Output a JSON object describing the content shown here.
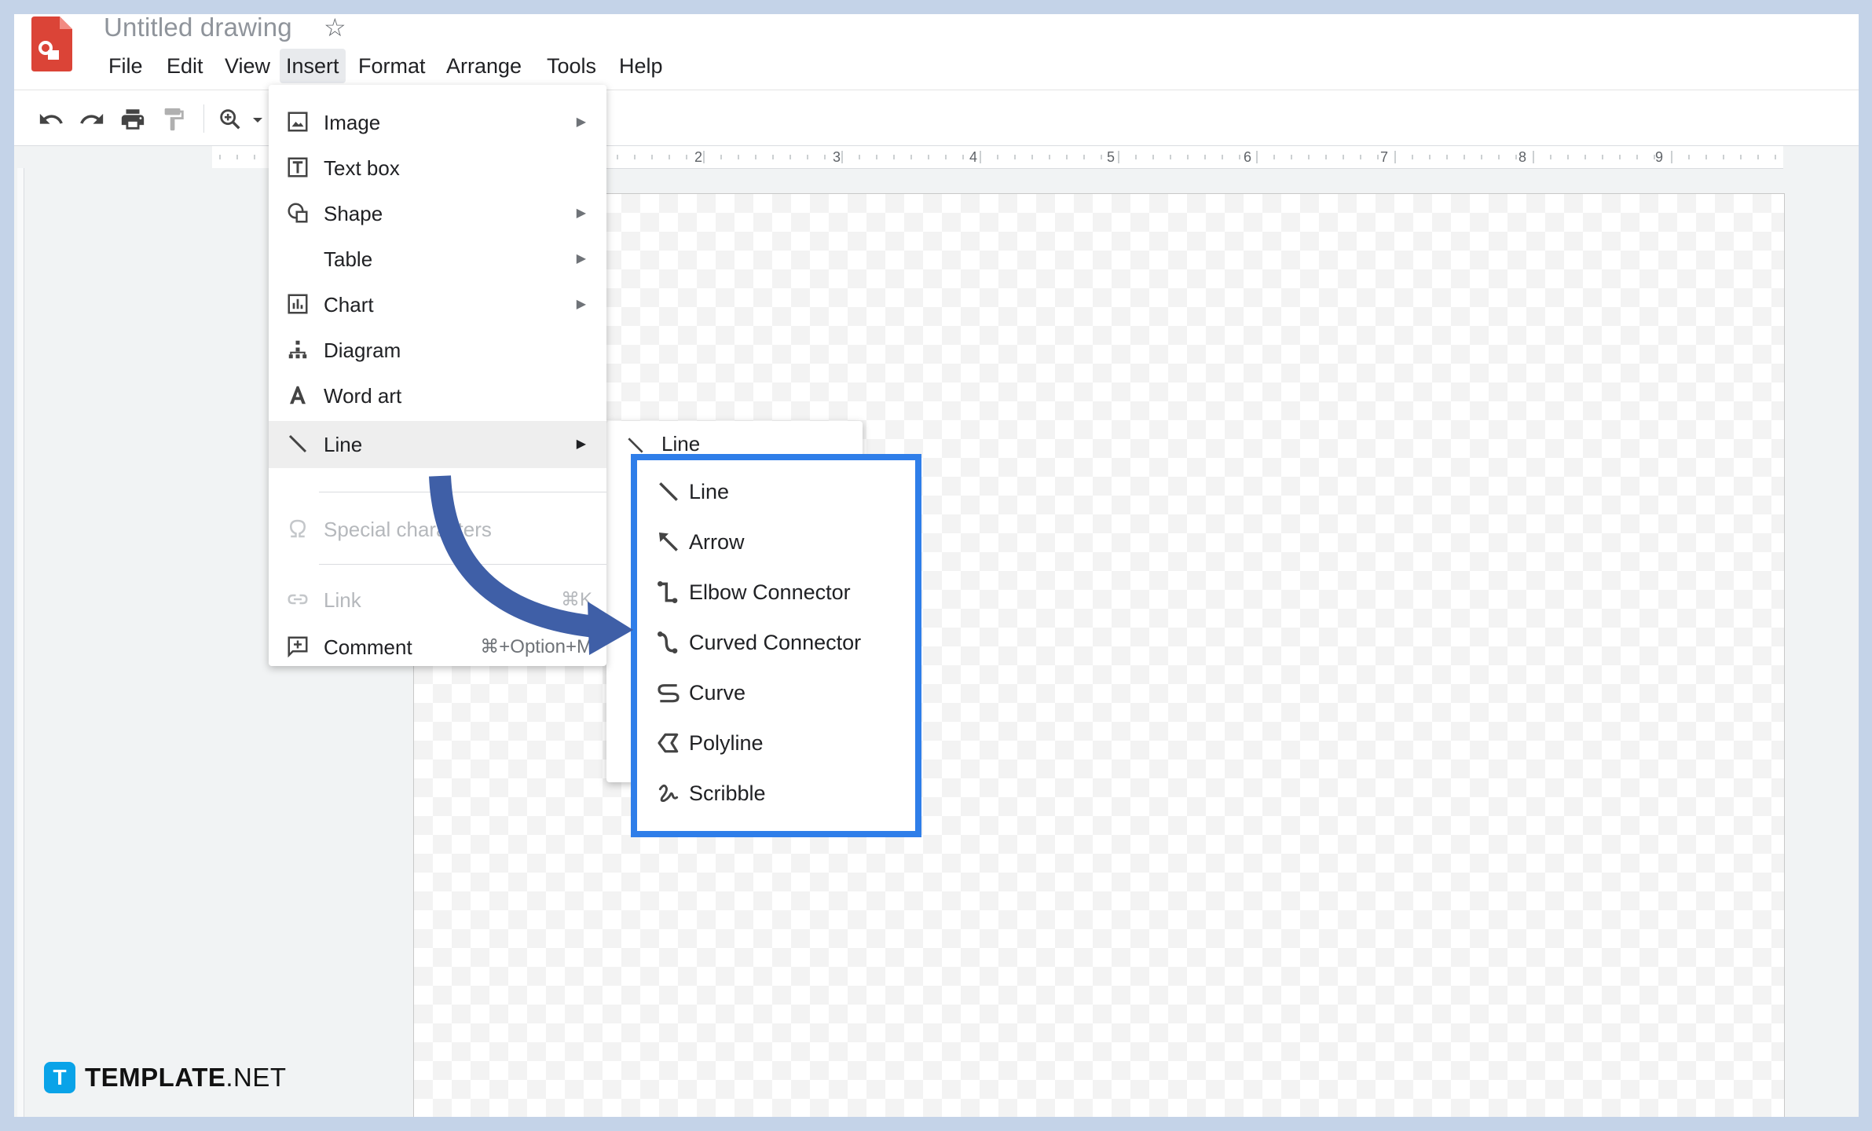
{
  "document": {
    "title": "Untitled drawing"
  },
  "menubar": {
    "items": [
      "File",
      "Edit",
      "View",
      "Insert",
      "Format",
      "Arrange",
      "Tools",
      "Help"
    ],
    "active": "Insert"
  },
  "ruler": {
    "numbers": [
      "2",
      "3",
      "4",
      "5",
      "6",
      "7",
      "8",
      "9"
    ]
  },
  "insert_menu": {
    "items": [
      {
        "label": "Image",
        "icon": "image-icon",
        "submenu": true
      },
      {
        "label": "Text box",
        "icon": "text-box-icon",
        "submenu": false
      },
      {
        "label": "Shape",
        "icon": "shape-icon",
        "submenu": true
      },
      {
        "label": "Table",
        "icon": "",
        "submenu": true
      },
      {
        "label": "Chart",
        "icon": "chart-icon",
        "submenu": true
      },
      {
        "label": "Diagram",
        "icon": "diagram-icon",
        "submenu": false
      },
      {
        "label": "Word art",
        "icon": "word-art-icon",
        "submenu": false
      },
      {
        "label": "Line",
        "icon": "line-icon",
        "submenu": true,
        "highlighted": true
      },
      {
        "label": "Special characters",
        "icon": "omega-icon",
        "disabled": true
      },
      {
        "label": "Link",
        "icon": "link-icon",
        "shortcut": "⌘K",
        "disabled": true
      },
      {
        "label": "Comment",
        "icon": "comment-icon",
        "shortcut": "⌘+Option+M"
      }
    ]
  },
  "line_submenu": {
    "partial_label": "Line",
    "items": [
      {
        "label": "Line",
        "icon": "line-icon"
      },
      {
        "label": "Arrow",
        "icon": "arrow-icon"
      },
      {
        "label": "Elbow Connector",
        "icon": "elbow-connector-icon"
      },
      {
        "label": "Curved Connector",
        "icon": "curved-connector-icon"
      },
      {
        "label": "Curve",
        "icon": "curve-icon"
      },
      {
        "label": "Polyline",
        "icon": "polyline-icon"
      },
      {
        "label": "Scribble",
        "icon": "scribble-icon"
      }
    ]
  },
  "colors": {
    "highlight_border": "#2f7ee9",
    "annotation_arrow": "#3f5fa7",
    "background": "#c4d3e8"
  },
  "watermark": {
    "brand_bold": "TEMPLATE",
    "brand_suffix": ".NET",
    "logo_letter": "T"
  }
}
